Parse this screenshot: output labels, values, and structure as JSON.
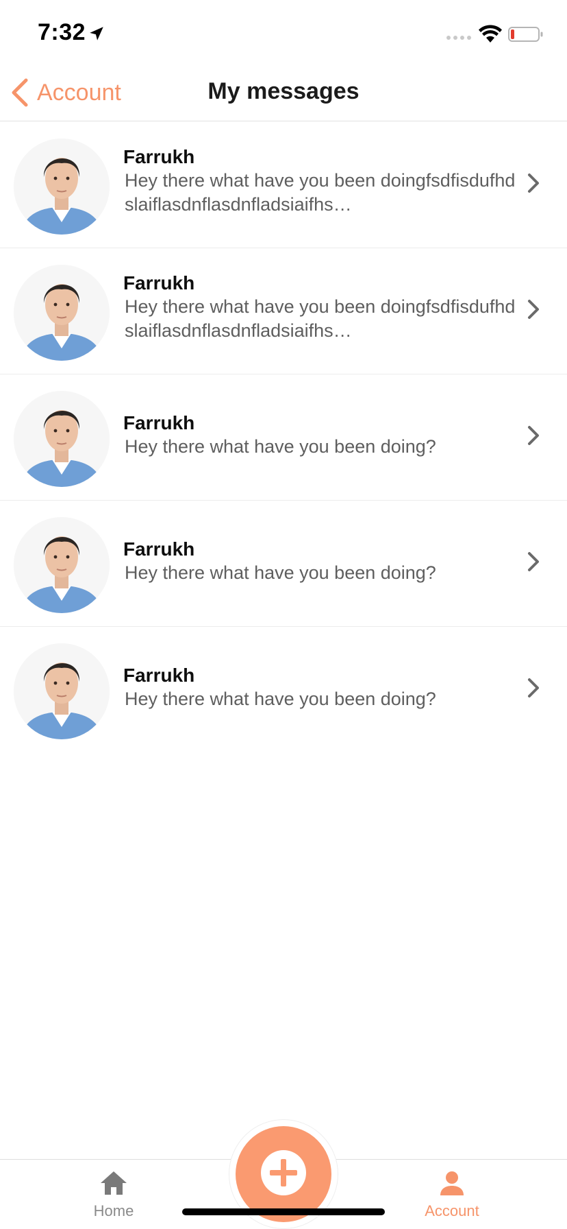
{
  "status_bar": {
    "time": "7:32",
    "icons": [
      "location-arrow-icon",
      "signal-dots-icon",
      "wifi-icon",
      "battery-low-icon"
    ]
  },
  "nav": {
    "back_label": "Account",
    "title": "My messages"
  },
  "messages": [
    {
      "sender": "Farrukh",
      "preview": "Hey there what have you been doingfsdfisdufhdslaiflasdnflasdnfladsiaifhs…",
      "avatar": "avatar-photo"
    },
    {
      "sender": "Farrukh",
      "preview": "Hey there what have you been doingfsdfisdufhdslaiflasdnflasdnfladsiaifhs…",
      "avatar": "avatar-photo"
    },
    {
      "sender": "Farrukh",
      "preview": "Hey there what have you been doing?",
      "avatar": "avatar-photo"
    },
    {
      "sender": "Farrukh",
      "preview": "Hey there what have you been doing?",
      "avatar": "avatar-photo"
    },
    {
      "sender": "Farrukh",
      "preview": "Hey there what have you been doing?",
      "avatar": "avatar-photo"
    }
  ],
  "tab_bar": {
    "home_label": "Home",
    "account_label": "Account",
    "fab_icon": "plus-icon"
  },
  "colors": {
    "accent": "#f6946a",
    "fab": "#fa9a70",
    "text_primary": "#0e0e0e",
    "text_secondary": "#5e5e5e",
    "tab_inactive": "#8a8a8a",
    "battery_low": "#e23b2e"
  }
}
